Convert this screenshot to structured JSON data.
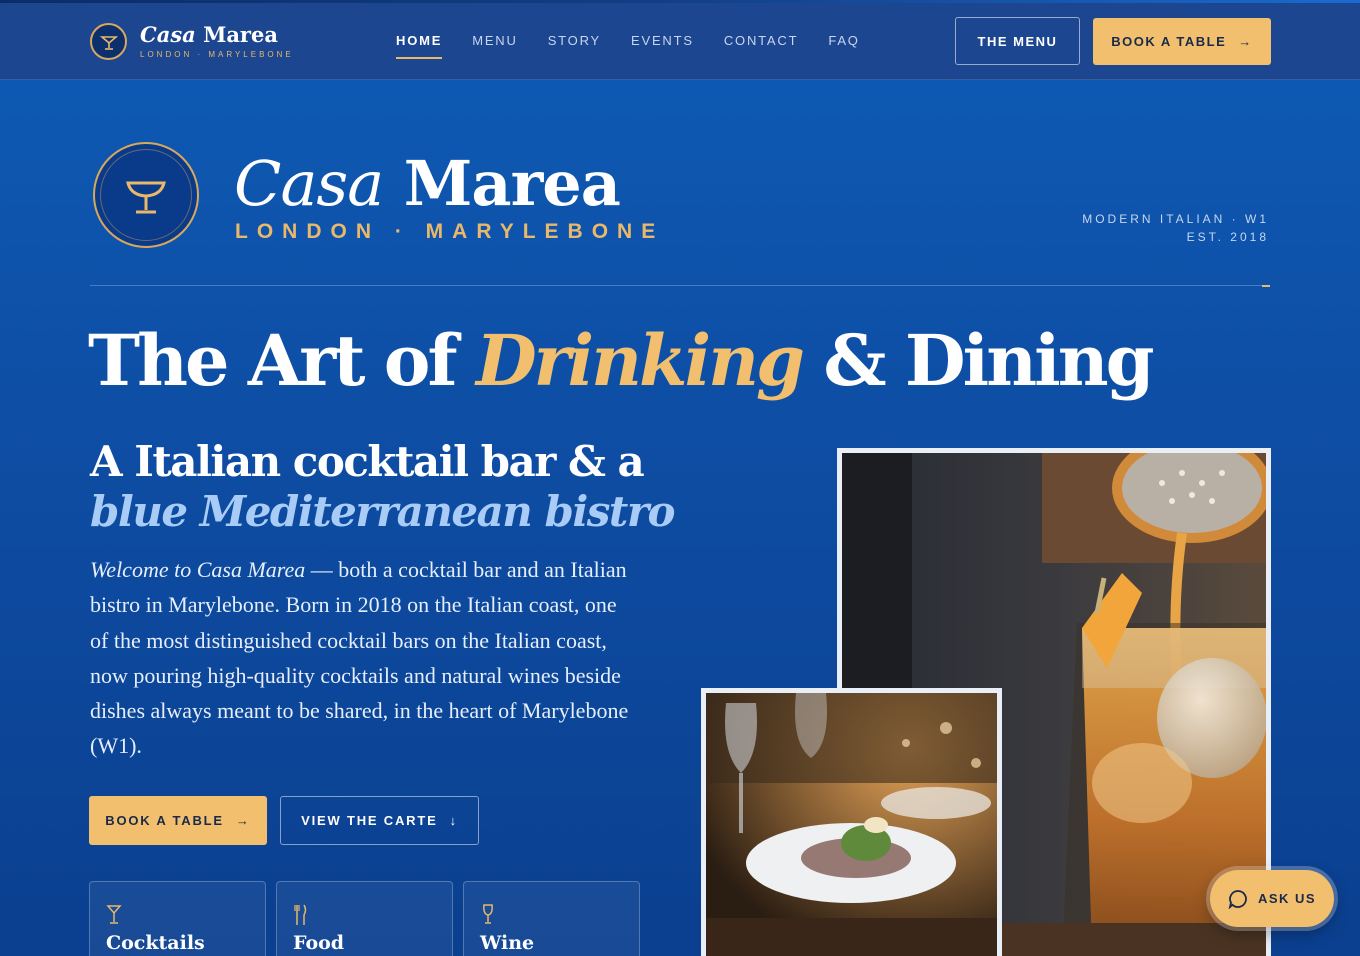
{
  "nav": {
    "brand_script": "Casa",
    "brand_name": "Marea",
    "brand_sub": "LONDON · MARYLEBONE",
    "links": [
      "HOME",
      "MENU",
      "STORY",
      "EVENTS",
      "CONTACT",
      "FAQ"
    ],
    "active": "HOME",
    "menu_button": "THE MENU",
    "book_button": "BOOK A TABLE"
  },
  "hero": {
    "name_script": "Casa",
    "name": "Marea",
    "sub": "LONDON · MARYLEBONE",
    "meta_line1": "MODERN ITALIAN · W1",
    "meta_line2": "EST. 2018",
    "headline_pre": "The Art of ",
    "headline_accent": "Drinking",
    "headline_post": " & Dining",
    "subheading_1": "A Italian cocktail bar & a",
    "subheading_2": "blue Mediterranean bistro",
    "intro_italic": "Welcome to Casa Marea",
    "intro_rest": " — both a cocktail bar and an Italian bistro in Marylebone. Born in 2018 on the Italian coast, one of the most distinguished cocktail bars on the Italian coast, now pouring high-quality cocktails and natural wines beside dishes always meant to be shared, in the heart of Marylebone (W1).",
    "book_button": "BOOK A TABLE",
    "carte_button": "VIEW THE CARTE"
  },
  "cards": [
    {
      "title": "Cocktails",
      "icon": "cocktail-glass-icon"
    },
    {
      "title": "Food",
      "icon": "fork-knife-icon"
    },
    {
      "title": "Wine",
      "icon": "wine-glass-icon"
    }
  ],
  "chat": {
    "label": "ASK US",
    "icon": "chat-bubble-icon"
  },
  "colors": {
    "accent": "#f1bf6d",
    "background": "#0e4fa6",
    "nav": "#1d4690",
    "highlight": "#a9ccf7"
  }
}
